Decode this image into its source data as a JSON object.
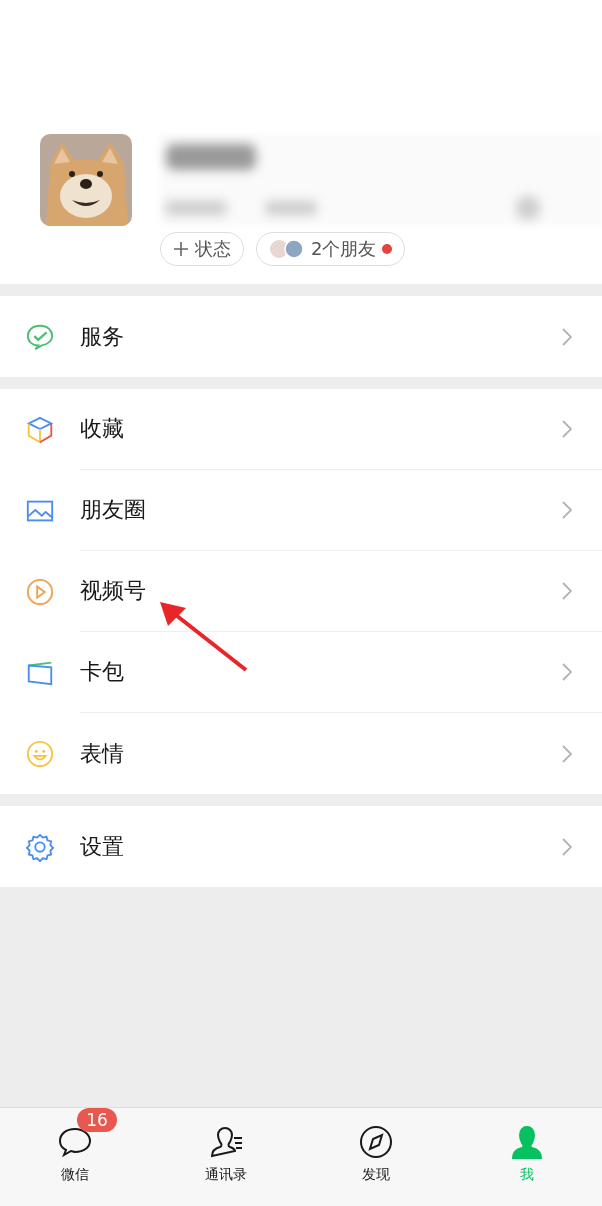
{
  "profile": {
    "status_button": "状态",
    "friends": {
      "label": "2个朋友",
      "unread": true
    }
  },
  "groups": [
    [
      {
        "label": "服务",
        "kind": "service"
      }
    ],
    [
      {
        "label": "收藏",
        "kind": "favorites"
      },
      {
        "label": "朋友圈",
        "kind": "moments"
      },
      {
        "label": "视频号",
        "kind": "channels"
      },
      {
        "label": "卡包",
        "kind": "cards"
      },
      {
        "label": "表情",
        "kind": "stickers"
      }
    ],
    [
      {
        "label": "设置",
        "kind": "settings"
      }
    ]
  ],
  "tabs": [
    {
      "label": "微信",
      "kind": "chat",
      "selected": false,
      "badge": "16"
    },
    {
      "label": "通讯录",
      "kind": "contacts",
      "selected": false
    },
    {
      "label": "发现",
      "kind": "discover",
      "selected": false
    },
    {
      "label": "我",
      "kind": "me",
      "selected": true
    }
  ]
}
